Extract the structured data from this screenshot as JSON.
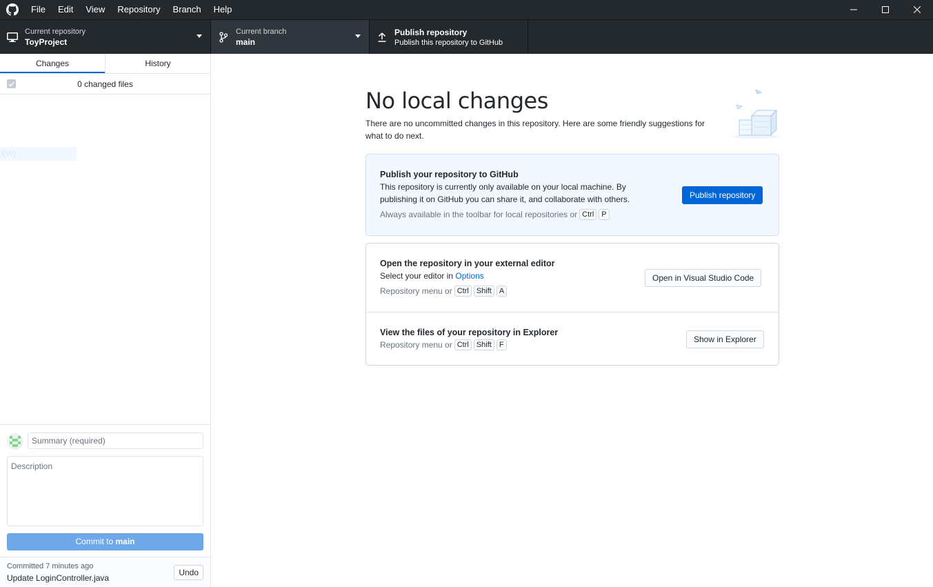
{
  "menu": [
    "File",
    "Edit",
    "View",
    "Repository",
    "Branch",
    "Help"
  ],
  "toolbar": {
    "repo_label": "Current repository",
    "repo_value": "ToyProject",
    "branch_label": "Current branch",
    "branch_value": "main",
    "publish_title": "Publish repository",
    "publish_subtitle": "Publish this repository to GitHub"
  },
  "sidebar": {
    "tabs": [
      "Changes",
      "History"
    ],
    "changed_files": "0 changed files",
    "ghost_item": "t(W)",
    "summary_placeholder": "Summary (required)",
    "description_placeholder": "Description",
    "commit_prefix": "Commit to ",
    "commit_branch": "main",
    "last_commit_ago": "Committed 7 minutes ago",
    "last_commit_msg": "Update LoginController.java",
    "undo_label": "Undo"
  },
  "main": {
    "title": "No local changes",
    "subtitle": "There are no uncommitted changes in this repository. Here are some friendly suggestions for what to do next.",
    "publish_card": {
      "title": "Publish your repository to GitHub",
      "desc": "This repository is currently only available on your local machine. By publishing it on GitHub you can share it, and collaborate with others.",
      "hint": "Always available in the toolbar for local repositories or",
      "keys": [
        "Ctrl",
        "P"
      ],
      "button": "Publish repository"
    },
    "editor_card": {
      "title": "Open the repository in your external editor",
      "desc_prefix": "Select your editor in ",
      "desc_link": "Options",
      "hint": "Repository menu or",
      "keys": [
        "Ctrl",
        "Shift",
        "A"
      ],
      "button": "Open in Visual Studio Code"
    },
    "explorer_card": {
      "title": "View the files of your repository in Explorer",
      "hint": "Repository menu or",
      "keys": [
        "Ctrl",
        "Shift",
        "F"
      ],
      "button": "Show in Explorer"
    }
  },
  "colors": {
    "titlebar": "#24292e",
    "accent": "#0366d6",
    "commit_disabled": "#6fa8e8",
    "publish_card_bg": "#f1f8ff"
  }
}
